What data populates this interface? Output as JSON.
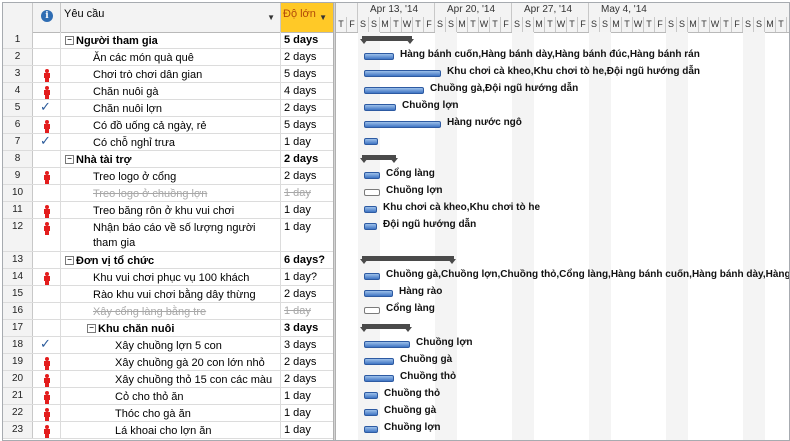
{
  "header": {
    "name_col": "Yêu cầu",
    "duration_col": "Độ lớn",
    "weeks": [
      "Apr 13, '14",
      "Apr 20, '14",
      "Apr 27, '14",
      "May 4, '14"
    ],
    "day_letters": [
      "T",
      "F",
      "S",
      "S",
      "M",
      "T",
      "W",
      "T",
      "F",
      "S",
      "S",
      "M",
      "T",
      "W",
      "T",
      "F",
      "S",
      "S",
      "M",
      "T",
      "W",
      "T",
      "F",
      "S",
      "S",
      "M",
      "T",
      "W",
      "T",
      "F",
      "S",
      "S",
      "M",
      "T",
      "W",
      "T",
      "F",
      "S",
      "S",
      "M",
      "T"
    ]
  },
  "tasks": [
    {
      "id": "1",
      "name": "Người tham gia",
      "duration": "5 days",
      "level": 0,
      "summary": true,
      "indicator": ""
    },
    {
      "id": "2",
      "name": "Ăn các món quà quê",
      "duration": "2 days",
      "level": 1,
      "indicator": ""
    },
    {
      "id": "3",
      "name": "Chơi trò chơi dân gian",
      "duration": "5 days",
      "level": 1,
      "indicator": "person"
    },
    {
      "id": "4",
      "name": "Chăn nuôi gà",
      "duration": "4 days",
      "level": 1,
      "indicator": "person"
    },
    {
      "id": "5",
      "name": "Chăn nuôi lợn",
      "duration": "2 days",
      "level": 1,
      "indicator": "check"
    },
    {
      "id": "6",
      "name": "Có đồ uống cả ngày, rẻ",
      "duration": "5 days",
      "level": 1,
      "indicator": "person"
    },
    {
      "id": "7",
      "name": "Có chỗ nghỉ trưa",
      "duration": "1 day",
      "level": 1,
      "indicator": "check"
    },
    {
      "id": "8",
      "name": "Nhà tài trợ",
      "duration": "2 days",
      "level": 0,
      "summary": true,
      "indicator": ""
    },
    {
      "id": "9",
      "name": "Treo logo ở cổng",
      "duration": "2 days",
      "level": 1,
      "indicator": "person"
    },
    {
      "id": "10",
      "name": "Treo logo ở chuồng lợn",
      "duration": "1 day",
      "level": 1,
      "indicator": "",
      "inactive": true
    },
    {
      "id": "11",
      "name": "Treo băng rôn ở khu vui chơi",
      "duration": "1 day",
      "level": 1,
      "indicator": "person"
    },
    {
      "id": "12",
      "name": "Nhận báo cáo về số lượng người tham gia",
      "duration": "1 day",
      "level": 1,
      "indicator": "person",
      "tall": true
    },
    {
      "id": "13",
      "name": "Đơn vị tổ chức",
      "duration": "6 days?",
      "level": 0,
      "summary": true,
      "indicator": ""
    },
    {
      "id": "14",
      "name": "Khu vui chơi phục vụ 100 khách",
      "duration": "1 day?",
      "level": 1,
      "indicator": "person"
    },
    {
      "id": "15",
      "name": "Rào khu vui chơi bằng dây thừng",
      "duration": "2 days",
      "level": 1,
      "indicator": ""
    },
    {
      "id": "16",
      "name": "Xây cổng làng bằng tre",
      "duration": "1 day",
      "level": 1,
      "indicator": "",
      "inactive": true
    },
    {
      "id": "17",
      "name": "Khu chăn nuôi",
      "duration": "3 days",
      "level": 1,
      "summary": true,
      "indicator": ""
    },
    {
      "id": "18",
      "name": "Xây chuồng lợn 5 con",
      "duration": "3 days",
      "level": 2,
      "indicator": "check"
    },
    {
      "id": "19",
      "name": "Xây chuồng gà 20 con lớn nhỏ",
      "duration": "2 days",
      "level": 2,
      "indicator": "person"
    },
    {
      "id": "20",
      "name": "Xây chuồng thỏ 15 con các màu",
      "duration": "2 days",
      "level": 2,
      "indicator": "person"
    },
    {
      "id": "21",
      "name": "Cỏ cho thỏ ăn",
      "duration": "1 day",
      "level": 2,
      "indicator": "person"
    },
    {
      "id": "22",
      "name": "Thóc cho gà ăn",
      "duration": "1 day",
      "level": 2,
      "indicator": "person"
    },
    {
      "id": "23",
      "name": "Lá khoai cho lợn ăn",
      "duration": "1 day",
      "level": 2,
      "indicator": "person"
    }
  ],
  "bar_labels": {
    "2": "Hàng bánh cuốn,Hàng bánh dày,Hàng bánh đúc,Hàng bánh rán",
    "3": "Khu chơi cà kheo,Khu chơi tò he,Đội ngũ hướng dẫn",
    "4": "Chuồng gà,Đội ngũ hướng dẫn",
    "5": "Chuồng lợn",
    "6": "Hàng nước ngô",
    "9": "Cổng làng",
    "10": "Chuồng lợn",
    "11": "Khu chơi cà kheo,Khu chơi tò he",
    "12": "Đội ngũ hướng dẫn",
    "14": "Chuồng gà,Chuồng lợn,Chuồng thỏ,Cổng làng,Hàng bánh cuốn,Hàng bánh dày,Hàng bánh đúc,",
    "15": "Hàng rào",
    "16": "Cổng làng",
    "18": "Chuồng lợn",
    "19": "Chuồng gà",
    "20": "Chuồng thỏ",
    "21": "Chuồng thỏ",
    "22": "Chuồng gà",
    "23": "Chuồng lợn"
  }
}
